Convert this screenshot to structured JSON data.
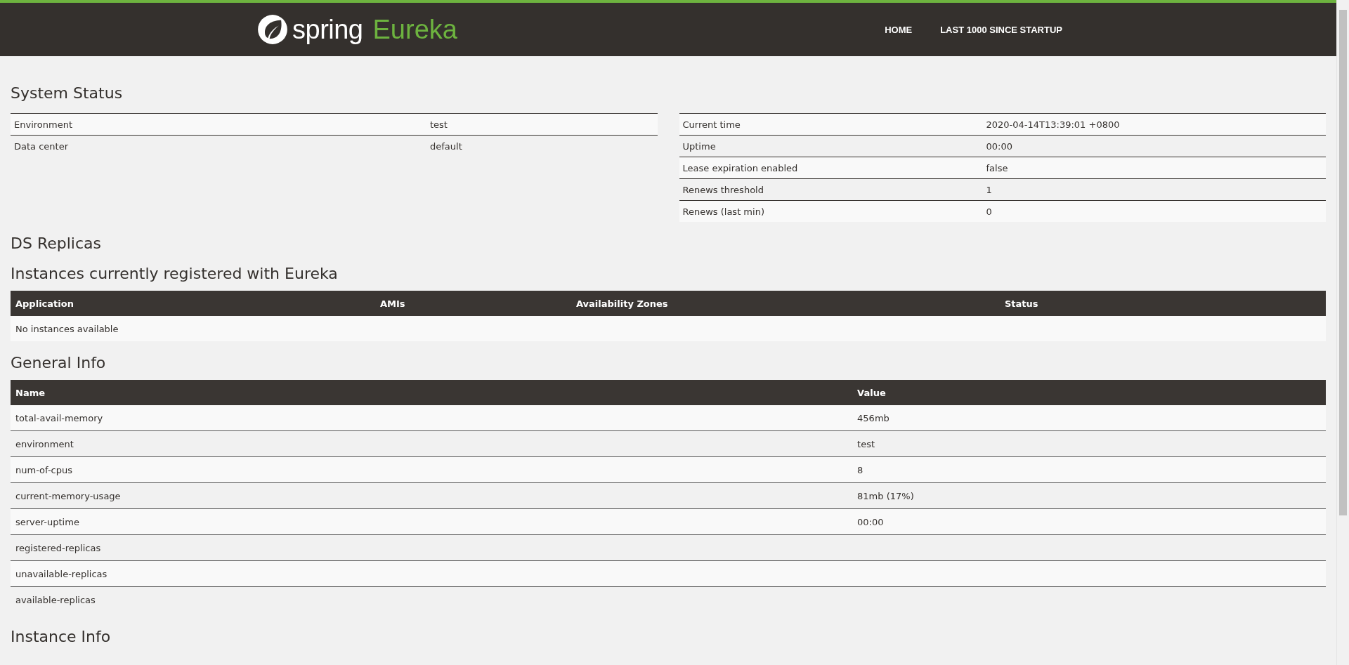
{
  "header": {
    "logo": {
      "word_1": "spring",
      "word_2": "Eureka"
    },
    "nav": [
      {
        "label": "HOME"
      },
      {
        "label": "LAST 1000 SINCE STARTUP"
      }
    ]
  },
  "system_status": {
    "title": "System Status",
    "left_table": [
      {
        "name": "Environment",
        "value": "test"
      },
      {
        "name": "Data center",
        "value": "default"
      }
    ],
    "right_table": [
      {
        "name": "Current time",
        "value": "2020-04-14T13:39:01 +0800"
      },
      {
        "name": "Uptime",
        "value": "00:00"
      },
      {
        "name": "Lease expiration enabled",
        "value": "false"
      },
      {
        "name": "Renews threshold",
        "value": "1"
      },
      {
        "name": "Renews (last min)",
        "value": "0"
      }
    ]
  },
  "ds_replicas": {
    "title": "DS Replicas"
  },
  "instances": {
    "title": "Instances currently registered with Eureka",
    "columns": [
      "Application",
      "AMIs",
      "Availability Zones",
      "Status"
    ],
    "empty_message": "No instances available"
  },
  "general_info": {
    "title": "General Info",
    "columns": [
      "Name",
      "Value"
    ],
    "rows": [
      {
        "name": "total-avail-memory",
        "value": "456mb"
      },
      {
        "name": "environment",
        "value": "test"
      },
      {
        "name": "num-of-cpus",
        "value": "8"
      },
      {
        "name": "current-memory-usage",
        "value": "81mb (17%)"
      },
      {
        "name": "server-uptime",
        "value": "00:00"
      },
      {
        "name": "registered-replicas",
        "value": ""
      },
      {
        "name": "unavailable-replicas",
        "value": ""
      },
      {
        "name": "available-replicas",
        "value": ""
      }
    ]
  },
  "instance_info": {
    "title": "Instance Info"
  }
}
